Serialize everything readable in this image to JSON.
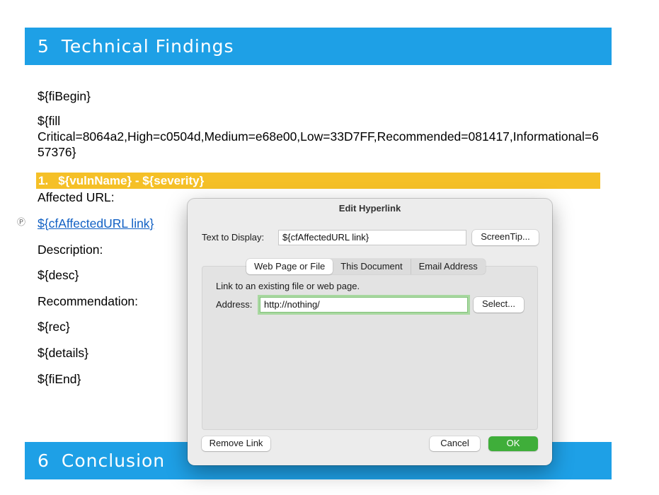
{
  "document": {
    "section5": {
      "number": "5",
      "title": "Technical Findings"
    },
    "fi_begin": "${fiBegin}",
    "fill_text_line1": "${fill",
    "fill_text_rest": "Critical=8064a2,High=c0504d,Medium=e68e00,Low=33D7FF,Recommended=081417,Informational=657376}",
    "vuln_heading": {
      "number": "1.",
      "text": "${vulnName} - ${severity}"
    },
    "affected_url_label": "Affected URL:",
    "affected_url_link": "${cfAffectedURL link}",
    "description_label": "Description:",
    "desc": "${desc}",
    "recommendation_label": "Recommendation:",
    "rec": "${rec}",
    "details": "${details}",
    "fi_end": "${fiEnd}",
    "section6": {
      "number": "6",
      "title": "Conclusion"
    },
    "colors": {
      "heading_bar": "#1ea0e6",
      "vuln_bar": "#f5c027",
      "link": "#1160c4"
    }
  },
  "dialog": {
    "title": "Edit Hyperlink",
    "text_to_display_label": "Text to Display:",
    "text_to_display_value": "${cfAffectedURL link}",
    "screentip_button": "ScreenTip...",
    "tabs": [
      {
        "label": "Web Page or File",
        "active": true
      },
      {
        "label": "This Document",
        "active": false
      },
      {
        "label": "Email Address",
        "active": false
      }
    ],
    "instruction": "Link to an existing file or web page.",
    "address_label": "Address:",
    "address_value": "http://nothing/",
    "select_button": "Select...",
    "remove_link_button": "Remove Link",
    "cancel_button": "Cancel",
    "ok_button": "OK",
    "colors": {
      "ok_button": "#3fae3a",
      "focus_ring": "#a8d8a0"
    }
  }
}
